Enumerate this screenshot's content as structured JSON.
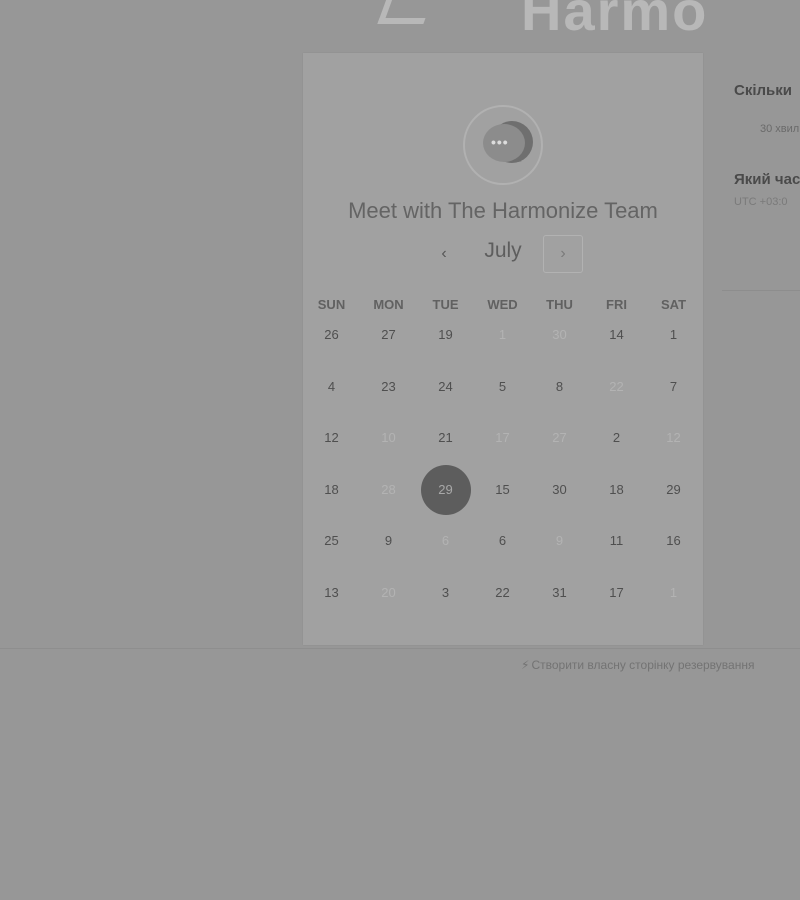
{
  "header": {
    "logo_text": "Harmo"
  },
  "card": {
    "title": "Meet with The Harmonize Team",
    "avatar_dots": "•••",
    "month": "July",
    "prev_label": "‹",
    "next_label": "›"
  },
  "calendar": {
    "weekdays": [
      "SUN",
      "MON",
      "TUE",
      "WED",
      "THU",
      "FRI",
      "SAT"
    ],
    "weeks": [
      [
        {
          "d": "26",
          "on": true
        },
        {
          "d": "27",
          "on": true
        },
        {
          "d": "19",
          "on": true
        },
        {
          "d": "1",
          "on": false
        },
        {
          "d": "30",
          "on": false
        },
        {
          "d": "14",
          "on": true
        },
        {
          "d": "1",
          "on": true
        }
      ],
      [
        {
          "d": "4",
          "on": true
        },
        {
          "d": "23",
          "on": true
        },
        {
          "d": "24",
          "on": true
        },
        {
          "d": "5",
          "on": true
        },
        {
          "d": "8",
          "on": true
        },
        {
          "d": "22",
          "on": false
        },
        {
          "d": "7",
          "on": true
        }
      ],
      [
        {
          "d": "12",
          "on": true
        },
        {
          "d": "10",
          "on": false
        },
        {
          "d": "21",
          "on": true
        },
        {
          "d": "17",
          "on": false
        },
        {
          "d": "27",
          "on": false
        },
        {
          "d": "2",
          "on": true
        },
        {
          "d": "12",
          "on": false
        }
      ],
      [
        {
          "d": "18",
          "on": true
        },
        {
          "d": "28",
          "on": false
        },
        {
          "d": "29",
          "on": true,
          "selected": true
        },
        {
          "d": "15",
          "on": true
        },
        {
          "d": "30",
          "on": true
        },
        {
          "d": "18",
          "on": true
        },
        {
          "d": "29",
          "on": true
        }
      ],
      [
        {
          "d": "25",
          "on": true
        },
        {
          "d": "9",
          "on": true
        },
        {
          "d": "6",
          "on": false
        },
        {
          "d": "6",
          "on": true
        },
        {
          "d": "9",
          "on": false
        },
        {
          "d": "11",
          "on": true
        },
        {
          "d": "16",
          "on": true
        }
      ],
      [
        {
          "d": "13",
          "on": true
        },
        {
          "d": "20",
          "on": false
        },
        {
          "d": "3",
          "on": true
        },
        {
          "d": "22",
          "on": true
        },
        {
          "d": "31",
          "on": true
        },
        {
          "d": "17",
          "on": true
        },
        {
          "d": "1",
          "on": false
        }
      ]
    ]
  },
  "side": {
    "duration_heading": "Скільки",
    "duration_option": "30 хвил",
    "time_heading": "Який час",
    "timezone": "UTC +03:0"
  },
  "footer": {
    "link_text": "Створити власну сторінку резервування",
    "icon": "⚡"
  }
}
